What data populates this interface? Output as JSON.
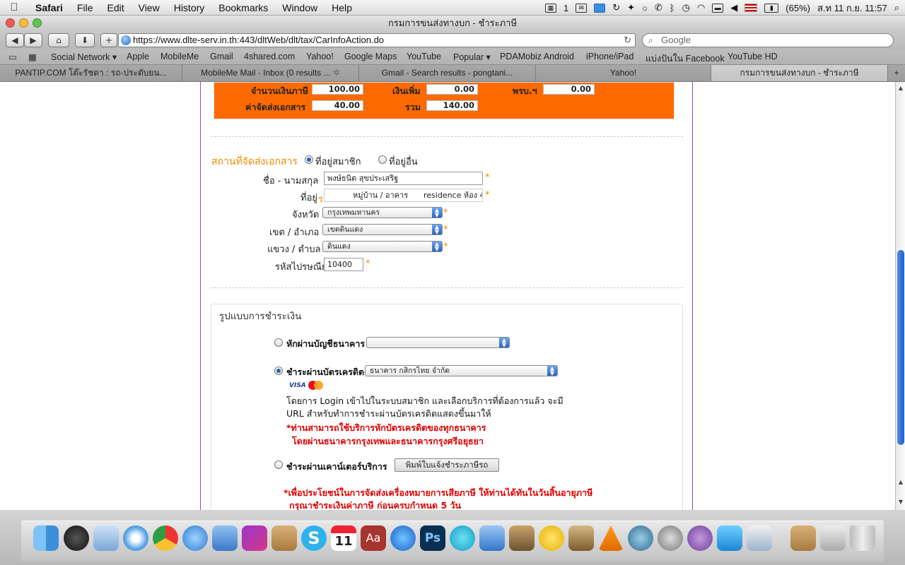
{
  "menubar": {
    "app_name": "Safari",
    "items": [
      "File",
      "Edit",
      "View",
      "History",
      "Bookmarks",
      "Window",
      "Help"
    ],
    "status": {
      "notification_count": "1",
      "battery": "(65%)",
      "datetime": "ส.ท 11 ก.ย.  11:57"
    }
  },
  "window": {
    "title": "กรมการขนส่งทางบก - ชำระภาษี"
  },
  "toolbar": {
    "url": "https://www.dlte-serv.in.th:443/dltWeb/dlt/tax/CarInfoAction.do",
    "search_placeholder": "Google"
  },
  "bookmarks": [
    "Social Network ▾",
    "Apple",
    "MobileMe",
    "Gmail",
    "4shared.com",
    "Yahoo!",
    "Google Maps",
    "YouTube",
    "Popular ▾",
    "PDAMobiz Android",
    "iPhone/iPad",
    "แบ่งปันใน Facebook",
    "YouTube HD"
  ],
  "tabs": [
    {
      "label": "PANTIP.COM โต๊ะรัชดา : รถ-ประดับยน..."
    },
    {
      "label": "MobileMe Mail - Inbox (0 results ..."
    },
    {
      "label": "Gmail - Search results - pongtani..."
    },
    {
      "label": "Yahoo!"
    },
    {
      "label": "กรมการขนส่งทางบก - ชำระภาษี"
    }
  ],
  "fees": {
    "tax_amount_label": "จำนวนเงินภาษี",
    "tax_amount_value": "100.00",
    "surcharge_label": "เงินเพิ่ม",
    "surcharge_value": "0.00",
    "prb_label": "พรบ.ฯ",
    "prb_value": "0.00",
    "delivery_fee_label": "ค่าจัดส่งเอกสาร",
    "delivery_fee_value": "40.00",
    "total_label": "รวม",
    "total_value": "140.00"
  },
  "delivery": {
    "section_title": "สถานที่จัดส่งเอกสาร",
    "option_member_address": "ที่อยู่สมาชิก",
    "option_other_address": "ที่อยู่อื่น",
    "name_label": "ชื่อ - นามสกุล",
    "name_value": "พงษ์ธนิต สุขประเสริฐ",
    "address_label": "ที่อยู่",
    "address_overlay": "ร",
    "address_village": "หมู่บ้าน / อาคาร",
    "address_residence": "residence ห้อง 4",
    "province_label": "จังหวัด",
    "province_value": "กรุงเทพมหานคร",
    "district_label": "เขต / อำเภอ",
    "district_value": "เขตดินแดง",
    "subdistrict_label": "แขวง / ตำบล",
    "subdistrict_value": "ดินแดง",
    "postcode_label": "รหัสไปรษณีย์",
    "postcode_value": "10400",
    "required_mark": "*"
  },
  "payment": {
    "section_title": "รูปแบบการชำระเงิน",
    "bank_debit_label": "หักผ่านบัญชีธนาคาร",
    "bank_debit_select": "",
    "credit_card_label": "ชำระผ่านบัตรเครดิต",
    "credit_card_select": "ธนาคาร กสิกรไทย จำกัด",
    "card_logo_visa": "VISA",
    "card_logo_mastercard": "MasterCard",
    "credit_info_line1": "โดยการ Login เข้าไปในระบบสมาชิก และเลือกบริการที่ต้องการแล้ว จะมี",
    "credit_info_line2": "URL สำหรับทำการชำระผ่านบัตรเครดิตแสดงขึ้นมาให้",
    "credit_note_line1": "*ท่านสามารถใช้บริการหักบัตรเครดิตของทุกธนาคาร",
    "credit_note_line2": "โดยผ่านธนาคารกรุงเทพและธนาคารกรุงศรีอยุธยา",
    "counter_label": "ชำระผ่านเคาน์เตอร์บริการ",
    "print_button": "พิมพ์ใบแจ้งชำระภาษีรถ",
    "bottom_note_line1": "*เพื่อประโยชน์ในการจัดส่งเครื่องหมายการเสียภาษี ให้ท่านได้ทันในวันสิ้นอายุภาษี",
    "bottom_note_line2": "กรุณาชำระเงินค่าภาษี ก่อนครบกำหนด 5 วัน"
  },
  "dock": {
    "calendar_day": "11",
    "dictionary_text": "Aa",
    "photoshop_text": "Ps",
    "icons": [
      "finder-icon",
      "dashboard-icon",
      "mail-icon",
      "safari-icon",
      "chrome-icon",
      "facetime-icon",
      "ichat-icon",
      "itunes-store-icon",
      "address-book-icon",
      "skype-icon",
      "ical-icon",
      "dictionary-icon",
      "itunes-icon",
      "photoshop-icon",
      "iweb-icon",
      "bluetooth-icon",
      "preview-icon",
      "cyberduck-icon",
      "iphoto-icon",
      "vlc-icon",
      "time-machine-icon",
      "system-preferences-icon",
      "app-icon",
      "app-icon-2",
      "app-icon-3",
      "documents-folder-icon",
      "downloads-stack-icon",
      "trash-icon"
    ]
  },
  "colors": {
    "accent_orange": "#ff6a00",
    "section_title": "#f08a00",
    "note_red": "#e00000",
    "page_border": "#9a4ab5"
  }
}
